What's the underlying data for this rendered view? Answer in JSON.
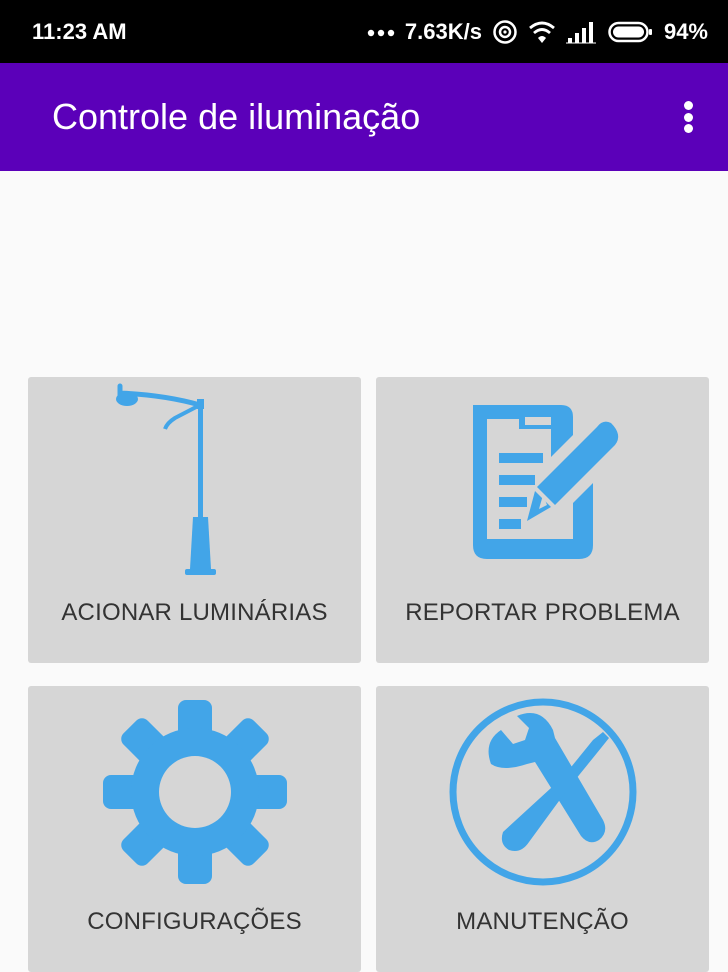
{
  "status_bar": {
    "time": "11:23 AM",
    "network_speed": "7.63K/s",
    "battery": "94%",
    "icons": [
      "more-dots-icon",
      "hotspot-icon",
      "wifi-icon",
      "signal-icon",
      "battery-icon"
    ]
  },
  "app_bar": {
    "title": "Controle de iluminação",
    "menu_icon": "overflow-menu-icon"
  },
  "tiles": [
    {
      "label": "ACIONAR LUMINÁRIAS",
      "icon": "street-lamp-icon"
    },
    {
      "label": "REPORTAR PROBLEMA",
      "icon": "report-edit-icon"
    },
    {
      "label": "CONFIGURAÇÕES",
      "icon": "gear-icon"
    },
    {
      "label": "MANUTENÇÃO",
      "icon": "tools-icon"
    }
  ],
  "colors": {
    "status_bar": "#000000",
    "app_bar": "#5b00b9",
    "background": "#fafafa",
    "tile": "#d6d6d6",
    "icon": "#42a5e8"
  }
}
